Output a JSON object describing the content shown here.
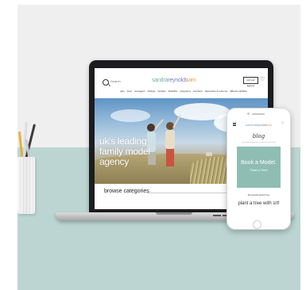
{
  "laptop_site": {
    "search_label": "Search",
    "logo": {
      "part1": "sandra",
      "part2": "reynolds",
      "part3": "wm"
    },
    "join_button": "join our agency",
    "heart_glyph": "♡",
    "nav": [
      "girls",
      "boys",
      "teenagers",
      "siblings",
      "families",
      "disability",
      "pregnancy",
      "bumbers",
      "alternative & extreme",
      "different abilities"
    ],
    "hero_title": "uk's leading family model agency",
    "browse_label": "browse categories"
  },
  "phone_site": {
    "logo": {
      "part1": "sandra",
      "part2": "reynolds",
      "part3": "wm"
    },
    "heart_glyph": "♡",
    "blog_title": "blog",
    "card_title": "Book a Model.",
    "card_subtitle": "Plant a Tree!",
    "hashtag": "#bookaModel4aTree",
    "body_text": "plant a tree with srt!"
  },
  "colors": {
    "wall": "#efefef",
    "desk": "#bcd5d2",
    "phone_card": "#8fbdb4",
    "logo_teal": "#6fb0a7",
    "logo_purple": "#7a7fbf",
    "logo_orange": "#e3a13b"
  }
}
